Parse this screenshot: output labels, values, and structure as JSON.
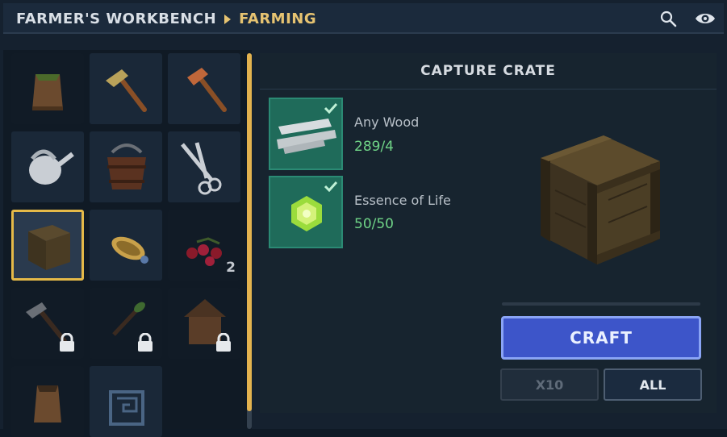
{
  "header": {
    "breadcrumb_root": "FARMER'S WORKBENCH",
    "breadcrumb_current": "FARMING",
    "icons": [
      "search-icon",
      "eye-icon"
    ]
  },
  "recipe_grid": {
    "slots": [
      {
        "item": "planter-box-icon",
        "selected": false,
        "locked": false,
        "count": ""
      },
      {
        "item": "hoe-icon",
        "selected": false,
        "locked": false,
        "count": ""
      },
      {
        "item": "copper-hoe-icon",
        "selected": false,
        "locked": false,
        "count": ""
      },
      {
        "item": "watering-can-icon",
        "selected": false,
        "locked": false,
        "count": ""
      },
      {
        "item": "bucket-icon",
        "selected": false,
        "locked": false,
        "count": ""
      },
      {
        "item": "shears-icon",
        "selected": false,
        "locked": false,
        "count": ""
      },
      {
        "item": "capture-crate-icon",
        "selected": true,
        "locked": false,
        "count": ""
      },
      {
        "item": "seed-spreader-icon",
        "selected": false,
        "locked": false,
        "count": ""
      },
      {
        "item": "berries-icon",
        "selected": false,
        "locked": false,
        "count": "2"
      },
      {
        "item": "iron-hoe-icon",
        "selected": false,
        "locked": true,
        "count": ""
      },
      {
        "item": "leaf-tool-icon",
        "selected": false,
        "locked": true,
        "count": ""
      },
      {
        "item": "birdhouse-icon",
        "selected": false,
        "locked": true,
        "count": ""
      },
      {
        "item": "planter-box-icon",
        "selected": false,
        "locked": false,
        "count": ""
      },
      {
        "item": "rune-block-icon",
        "selected": false,
        "locked": false,
        "count": ""
      }
    ]
  },
  "detail": {
    "title": "CAPTURE CRATE",
    "ingredients": [
      {
        "name": "Any Wood",
        "count": "289/4",
        "icon": "wood-planks-icon"
      },
      {
        "name": "Essence of Life",
        "count": "50/50",
        "icon": "essence-of-life-icon"
      }
    ],
    "preview_icon": "capture-crate-icon"
  },
  "actions": {
    "craft_label": "CRAFT",
    "x10_label": "X10",
    "all_label": "ALL"
  },
  "colors": {
    "accent_gold": "#e6c371",
    "craft_blue": "#3d55c9",
    "ingredient_green": "#1f6b5a",
    "count_green": "#6fd487"
  }
}
